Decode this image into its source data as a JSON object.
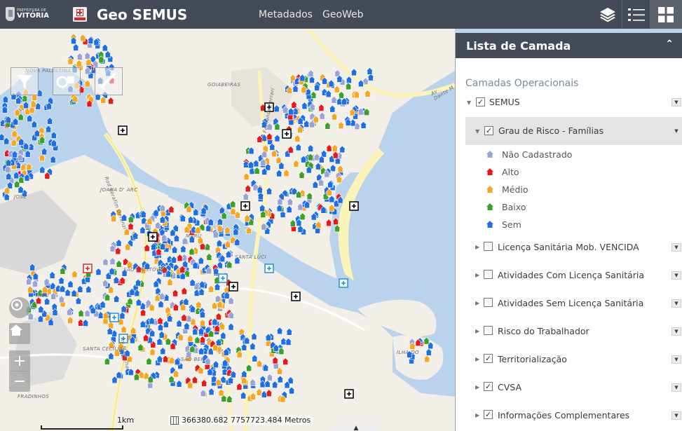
{
  "header": {
    "logo_small": "PREFEITURA DE",
    "logo_big": "VITÓRIA",
    "app_title": "Geo SEMUS",
    "nav": [
      "Metadados",
      "GeoWeb"
    ],
    "buttons": [
      "layers-icon",
      "list-icon",
      "grid-icon"
    ]
  },
  "map": {
    "labels": {
      "nova_palestina": "NOVA PALESTINA",
      "goiabeiras": "GOIABEIRAS",
      "joana_darc": "JOANA D' ARC",
      "sao_cristovao": "SÃO CRISTÓVÃO",
      "santa_cecilia": "SANTA CECÍLIA",
      "fradinhos": "FRADINHOS",
      "tabuazeiro": "TABU",
      "santa_lucia": "SANTA LÚCI",
      "maruipe": "MARU",
      "sao_benedito": "SÃO BEN",
      "jose": "JOSÉ",
      "ilha": "ILHA DO",
      "av_dante": "Av Dante M",
      "rod_serafim": "Rod Serafim Derenzi",
      "av_fernando": "Av Fernando Ferrari",
      "av_marechal": "Av Marechal"
    },
    "scale_label": "1km",
    "coordinates": "366380.682 7757723.484 Metros",
    "collapse_glyph": "▲"
  },
  "panel": {
    "title": "Lista de Camada",
    "section_title": "Camadas Operacionais",
    "layers": [
      {
        "label": "SEMUS",
        "checked": true,
        "expanded": true,
        "indent": 0
      },
      {
        "label": "Grau de Risco - Famílias",
        "checked": true,
        "expanded": true,
        "indent": 1,
        "selected": true
      },
      {
        "label": "Licença Sanitária Mob. VENCIDA",
        "checked": false,
        "expanded": false,
        "indent": 1
      },
      {
        "label": "Atividades Com Licença Sanitária",
        "checked": false,
        "expanded": false,
        "indent": 1
      },
      {
        "label": "Atividades Sem Licença Sanitária",
        "checked": false,
        "expanded": false,
        "indent": 1
      },
      {
        "label": "Risco do Trabalhador",
        "checked": false,
        "expanded": false,
        "indent": 1
      },
      {
        "label": "Territorialização",
        "checked": true,
        "expanded": false,
        "indent": 1
      },
      {
        "label": "CVSA",
        "checked": true,
        "expanded": false,
        "indent": 1
      },
      {
        "label": "Informações Complementares",
        "checked": true,
        "expanded": false,
        "indent": 1
      }
    ],
    "legend": [
      {
        "label": "Não Cadastrado",
        "color": "#9aa3d6"
      },
      {
        "label": "Alto",
        "color": "#e41a1c"
      },
      {
        "label": "Médio",
        "color": "#f5a623"
      },
      {
        "label": "Baixo",
        "color": "#3aa02a"
      },
      {
        "label": "Sem",
        "color": "#1f6fe0"
      }
    ]
  },
  "colors": {
    "header_bg": "#454b56",
    "water": "#b9d3ec",
    "land": "#f2efe9",
    "road": "#fbf3b8",
    "risk_none": "#9aa3d6",
    "risk_high": "#e41a1c",
    "risk_medium": "#f5a623",
    "risk_low": "#3aa02a",
    "risk_zero": "#1f6fe0"
  }
}
